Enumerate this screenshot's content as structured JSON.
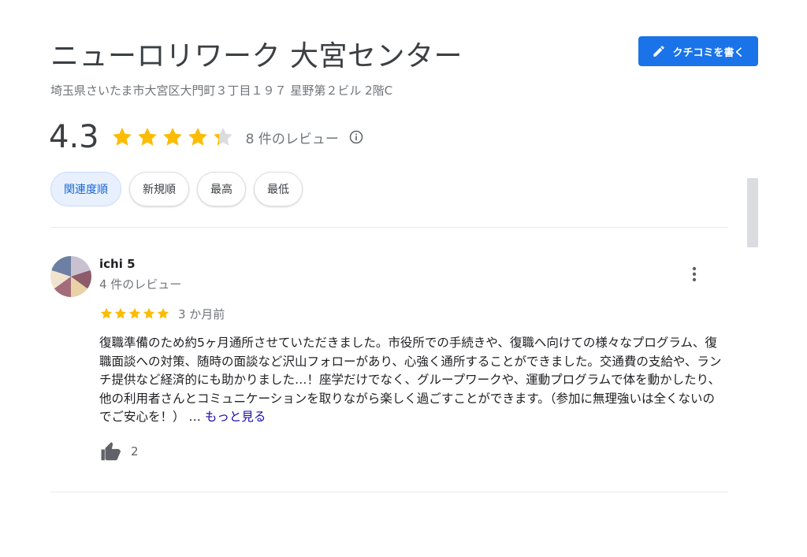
{
  "place": {
    "name": "ニューロリワーク 大宮センター",
    "address": "埼玉県さいたま市大宮区大門町３丁目１９７ 星野第２ビル 2階C"
  },
  "write_review_label": "クチコミを書く",
  "rating": {
    "value": "4.3",
    "stars_fill": 4.3,
    "count_label": "8 件のレビュー"
  },
  "sort_chips": [
    {
      "label": "関連度順",
      "active": true
    },
    {
      "label": "新規順",
      "active": false
    },
    {
      "label": "最高",
      "active": false
    },
    {
      "label": "最低",
      "active": false
    }
  ],
  "review": {
    "author": "ichi 5",
    "author_meta": "4 件のレビュー",
    "stars": 5,
    "time": "3 か月前",
    "text": "復職準備のため約5ヶ月通所させていただきました。市役所での手続きや、復職へ向けての様々なプログラム、復職面談への対策、随時の面談など沢山フォローがあり、心強く通所することができました。交通費の支給や、ランチ提供など経済的にも助かりました…！座学だけでなく、グループワークや、運動プログラムで体を動かしたり、他の利用者さんとコミュニケーションを取りながら楽しく過ごすことができます。（参加に無理強いは全くないのでご安心を！） …",
    "more_label": "もっと見る",
    "likes": "2"
  },
  "colors": {
    "accent": "#1a73e8",
    "star": "#fbbc04",
    "star_empty": "#dadce0"
  }
}
